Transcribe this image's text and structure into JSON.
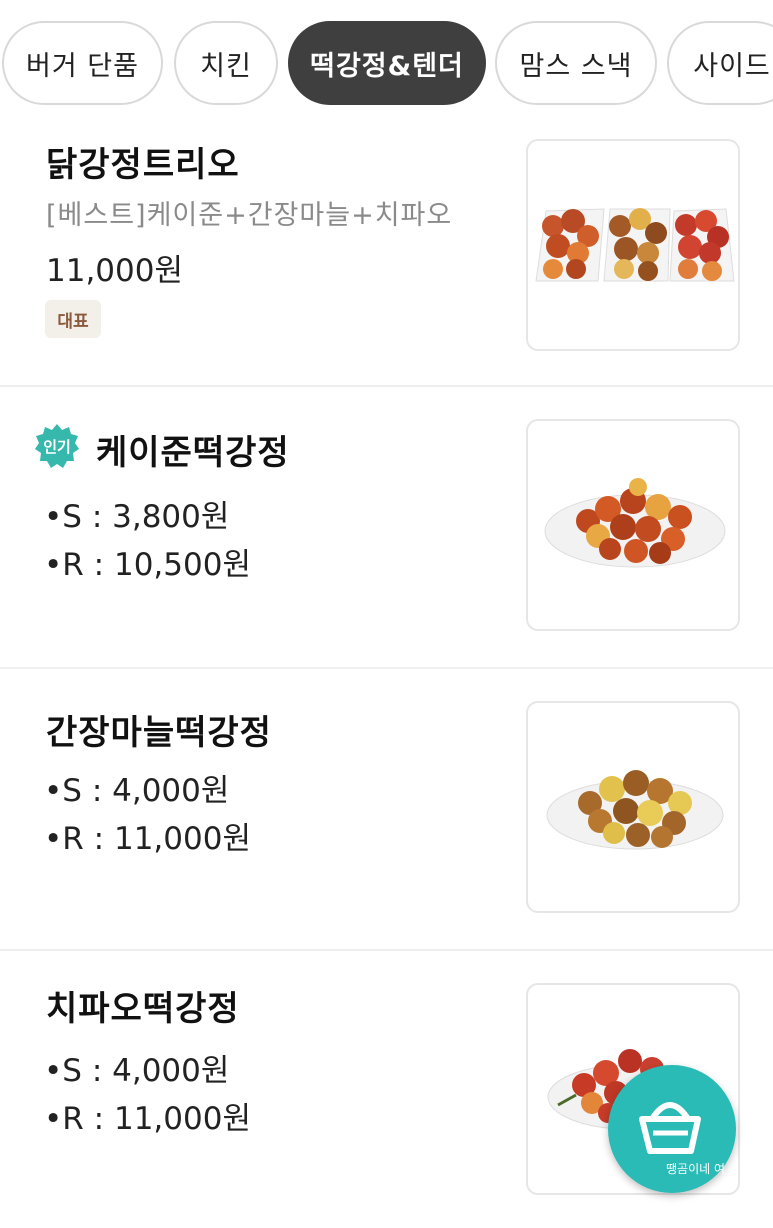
{
  "tabs": [
    {
      "label": "버거 단품",
      "active": false
    },
    {
      "label": "치킨",
      "active": false
    },
    {
      "label": "떡강정&텐더",
      "active": true
    },
    {
      "label": "맘스 스낵",
      "active": false
    },
    {
      "label": "사이드",
      "active": false
    }
  ],
  "items": [
    {
      "title": "닭강정트리오",
      "desc": "[베스트]케이준+간장마늘+치파오",
      "price": "11,000원",
      "badge": "대표"
    },
    {
      "title": "케이준떡강정",
      "badge": "인기",
      "prices": [
        "•S : 3,800원",
        "•R : 10,500원"
      ]
    },
    {
      "title": "간장마늘떡강정",
      "prices": [
        "•S : 4,000원",
        "•R : 11,000원"
      ]
    },
    {
      "title": "치파오떡강정",
      "prices": [
        "•S : 4,000원",
        "•R : 11,000원"
      ]
    }
  ],
  "cart_button": {
    "caption": "땡곰이네 여"
  },
  "colors": {
    "accent": "#2abbb7",
    "active_tab": "#3f3f3f",
    "badge_rep_bg": "#f3efe9"
  }
}
